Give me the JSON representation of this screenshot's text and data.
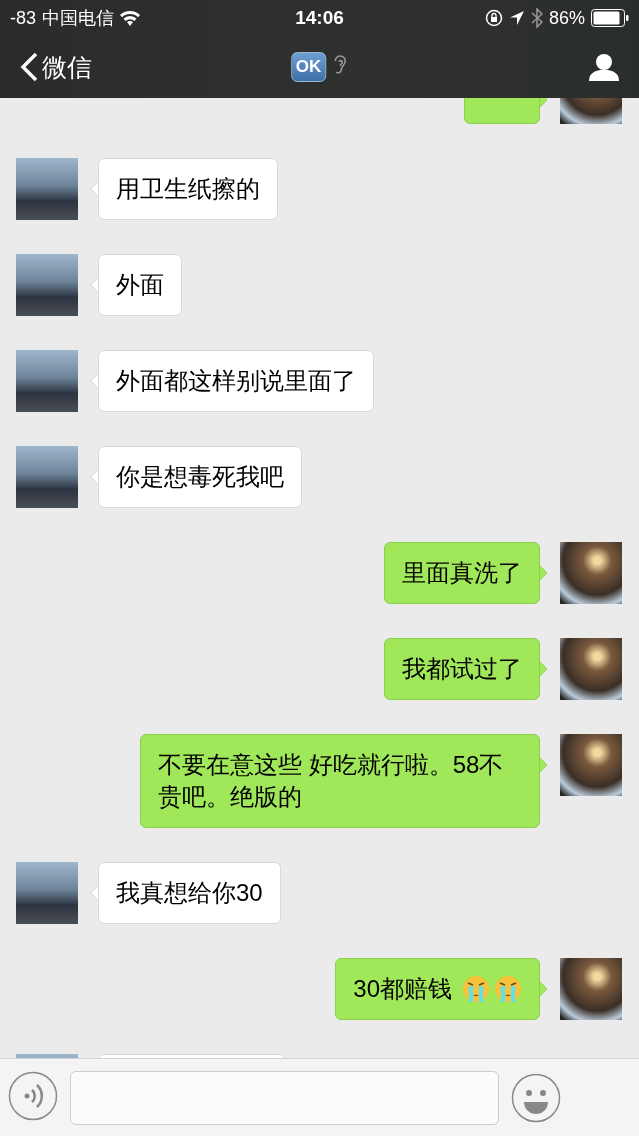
{
  "status_bar": {
    "signal": "-83",
    "carrier": "中国电信",
    "time": "14:06",
    "battery": "86%"
  },
  "nav": {
    "back": "微信",
    "title_badge": "OK",
    "earpiece_mode": true
  },
  "messages": [
    {
      "kind": "partial-top",
      "outgoing": true
    },
    {
      "kind": "text",
      "outgoing": false,
      "text": "用卫生纸擦的"
    },
    {
      "kind": "text",
      "outgoing": false,
      "text": "外面"
    },
    {
      "kind": "text",
      "outgoing": false,
      "text": "外面都这样别说里面了"
    },
    {
      "kind": "text",
      "outgoing": false,
      "text": "你是想毒死我吧"
    },
    {
      "kind": "text",
      "outgoing": true,
      "text": "里面真洗了"
    },
    {
      "kind": "text",
      "outgoing": true,
      "text": "我都试过了"
    },
    {
      "kind": "text",
      "outgoing": true,
      "text": "不要在意这些 好吃就行啦。58不贵吧。绝版的"
    },
    {
      "kind": "text",
      "outgoing": false,
      "text": "我真想给你30"
    },
    {
      "kind": "text",
      "outgoing": true,
      "text": "30都赔钱",
      "emojis": [
        {
          "kind": "crying"
        },
        {
          "kind": "crying"
        }
      ]
    },
    {
      "kind": "partial-bottom",
      "outgoing": false
    }
  ],
  "input_bar": {
    "voice_mode": true
  }
}
